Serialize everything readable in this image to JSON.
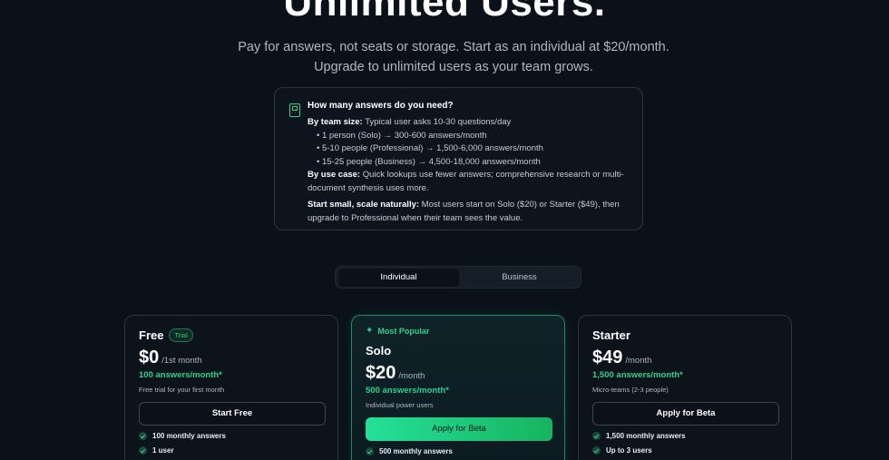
{
  "hero": {
    "title": "Unlimited Users.",
    "subtitle": "Pay for answers, not seats or storage. Start as an individual at $20/month. Upgrade to unlimited users as your team grows."
  },
  "info": {
    "title": "How many answers do you need?",
    "team_size_label": "By team size:",
    "team_size_text": "Typical user asks 10-30 questions/day",
    "bullets": [
      "• 1 person (Solo) → 300-600 answers/month",
      "• 5-10 people (Professional) → 1,500-6,000 answers/month",
      "• 15-25 people (Business) → 4,500-18,000 answers/month"
    ],
    "use_case_label": "By use case:",
    "use_case_text": "Quick lookups use fewer answers; comprehensive research or multi-document synthesis uses more.",
    "scale_label": "Start small, scale naturally:",
    "scale_text": "Most users start on Solo ($20) or Starter ($49), then upgrade to Professional when their team sees the value."
  },
  "toggle": {
    "options": [
      "Individual",
      "Business"
    ],
    "selected": "Individual"
  },
  "plans": [
    {
      "name": "Free",
      "badge": "Trial",
      "price": "$0",
      "period": "/1st month",
      "answers": "100 answers/month*",
      "desc": "Free trial for your first month",
      "cta": "Start Free",
      "features": [
        "100 monthly answers",
        "1 user"
      ]
    },
    {
      "tag": "Most Popular",
      "name": "Solo",
      "price": "$20",
      "period": "/month",
      "answers": "500 answers/month*",
      "desc": "Individual power users",
      "cta": "Apply for Beta",
      "features": [
        "500 monthly answers"
      ]
    },
    {
      "name": "Starter",
      "price": "$49",
      "period": "/month",
      "answers": "1,500 answers/month*",
      "desc": "Micro-teams (2-3 people)",
      "cta": "Apply for Beta",
      "features": [
        "1,500 monthly answers",
        "Up to 3 users"
      ]
    }
  ],
  "colors": {
    "accent": "#2fd18a",
    "background": "#0b1119"
  }
}
